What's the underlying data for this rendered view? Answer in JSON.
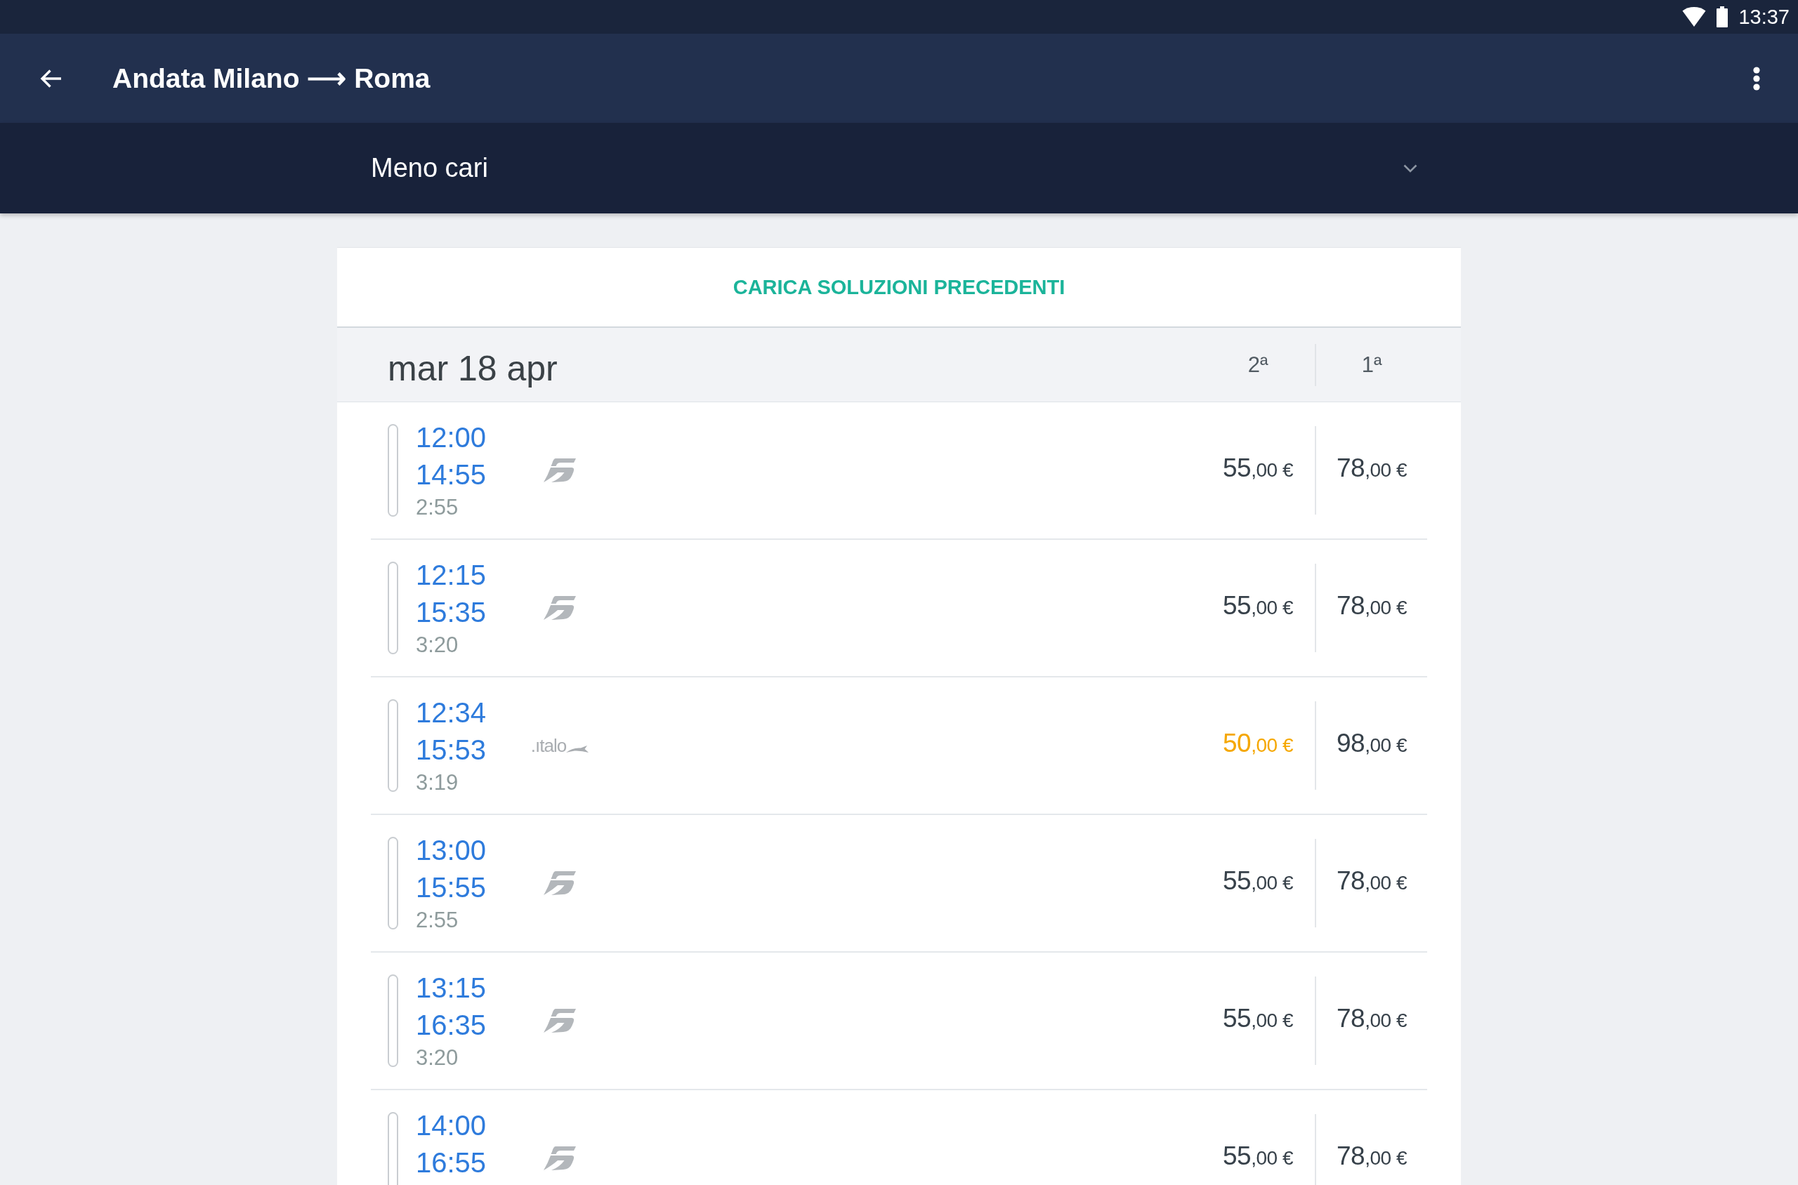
{
  "status_bar": {
    "time": "13:37"
  },
  "app_bar": {
    "title": "Andata Milano ⟶ Roma"
  },
  "sort": {
    "value": "Meno cari"
  },
  "load_earlier": {
    "label": "CARICA SOLUZIONI PRECEDENTI"
  },
  "date_header": {
    "date": "mar 18 apr",
    "class_columns": [
      "2ª",
      "1ª"
    ]
  },
  "solutions": [
    {
      "departure": "12:00",
      "arrival": "14:55",
      "duration": "2:55",
      "operator": {
        "kind": "emblem"
      },
      "prices": [
        {
          "amount": "55",
          "decimals": ",00 €",
          "highlighted": false
        },
        {
          "amount": "78",
          "decimals": ",00 €",
          "highlighted": false
        }
      ]
    },
    {
      "departure": "12:15",
      "arrival": "15:35",
      "duration": "3:20",
      "operator": {
        "kind": "emblem"
      },
      "prices": [
        {
          "amount": "55",
          "decimals": ",00 €",
          "highlighted": false
        },
        {
          "amount": "78",
          "decimals": ",00 €",
          "highlighted": false
        }
      ]
    },
    {
      "departure": "12:34",
      "arrival": "15:53",
      "duration": "3:19",
      "operator": {
        "kind": "wordmark",
        "text": ".ıtalo"
      },
      "prices": [
        {
          "amount": "50",
          "decimals": ",00 €",
          "highlighted": true
        },
        {
          "amount": "98",
          "decimals": ",00 €",
          "highlighted": false
        }
      ]
    },
    {
      "departure": "13:00",
      "arrival": "15:55",
      "duration": "2:55",
      "operator": {
        "kind": "emblem"
      },
      "prices": [
        {
          "amount": "55",
          "decimals": ",00 €",
          "highlighted": false
        },
        {
          "amount": "78",
          "decimals": ",00 €",
          "highlighted": false
        }
      ]
    },
    {
      "departure": "13:15",
      "arrival": "16:35",
      "duration": "3:20",
      "operator": {
        "kind": "emblem"
      },
      "prices": [
        {
          "amount": "55",
          "decimals": ",00 €",
          "highlighted": false
        },
        {
          "amount": "78",
          "decimals": ",00 €",
          "highlighted": false
        }
      ]
    },
    {
      "departure": "14:00",
      "arrival": "16:55",
      "operator": {
        "kind": "emblem"
      },
      "prices": [
        {
          "amount": "55",
          "decimals": ",00 €",
          "highlighted": false
        },
        {
          "amount": "78",
          "decimals": ",00 €",
          "highlighted": false
        }
      ]
    }
  ]
}
